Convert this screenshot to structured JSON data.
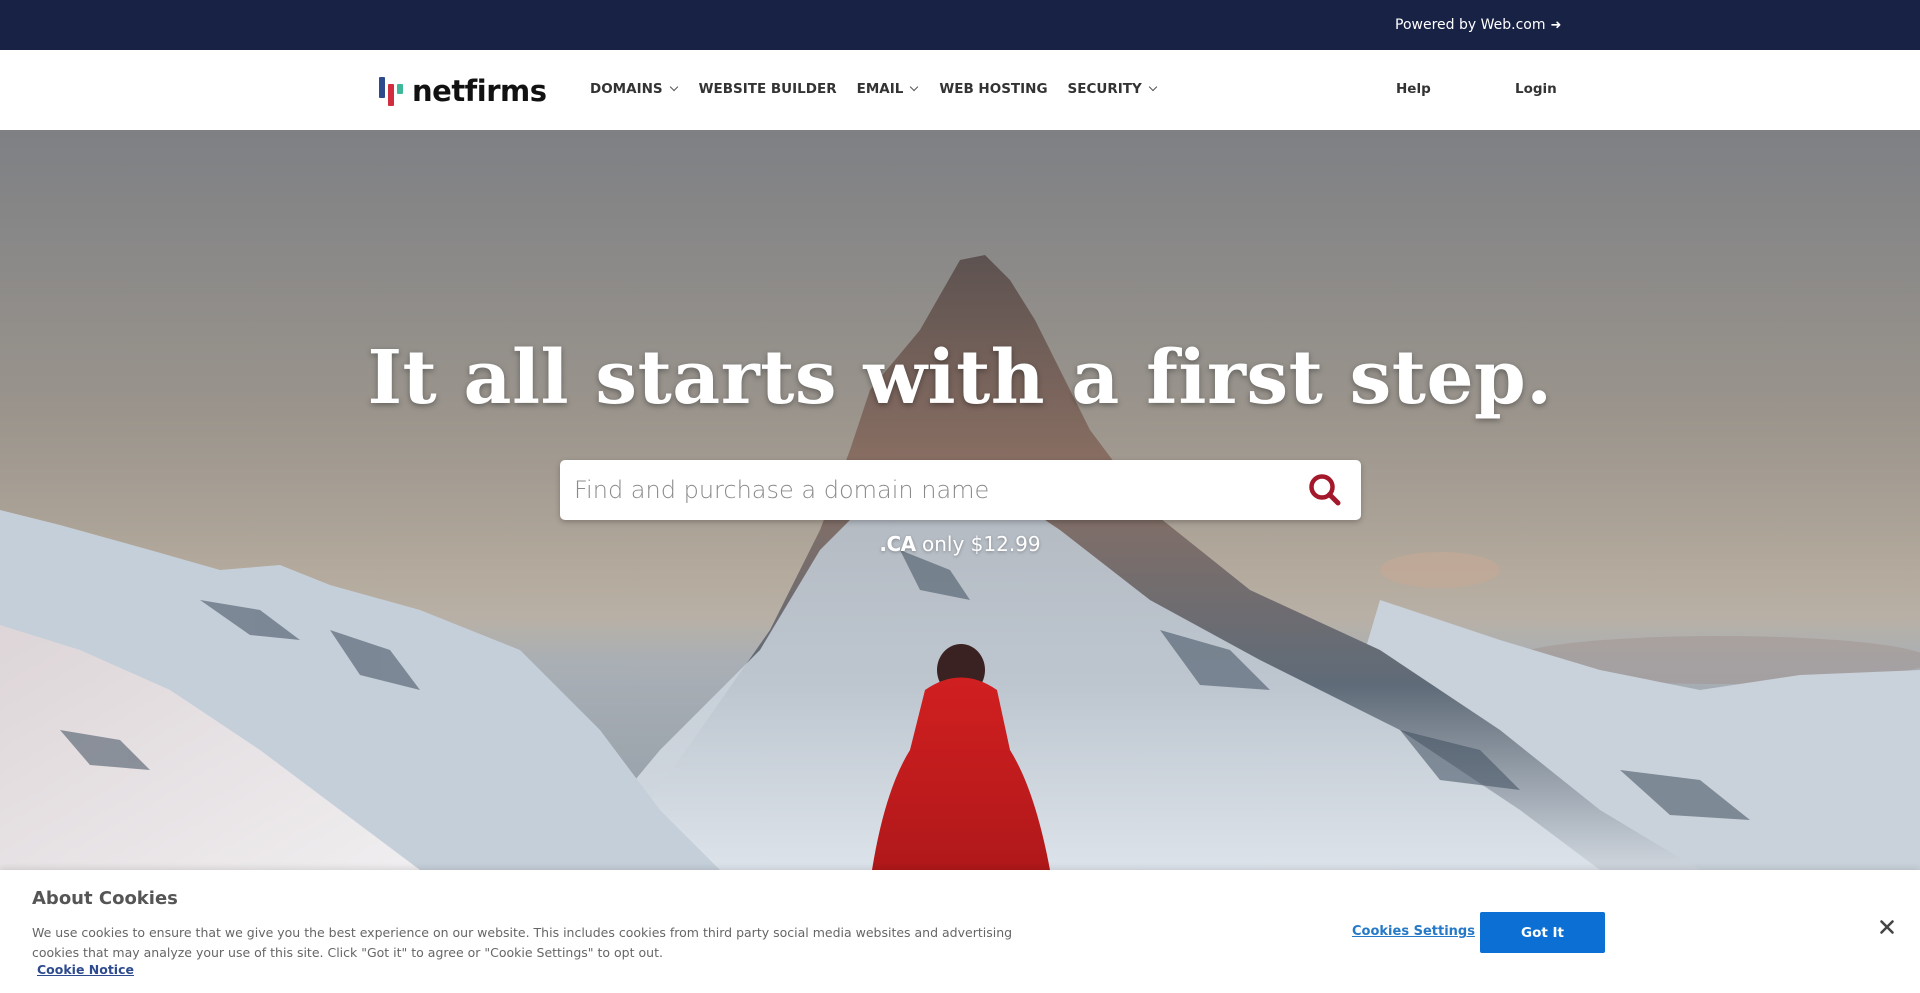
{
  "topbar": {
    "powered_by": "Powered by Web.com",
    "arrow_icon": "arrow-right-icon"
  },
  "nav": {
    "logo_text": "netfirms",
    "logo_colors": [
      "#2c4a8c",
      "#d12d3e",
      "#3fb89a"
    ],
    "items": [
      {
        "label": "DOMAINS",
        "dropdown": true
      },
      {
        "label": "WEBSITE BUILDER",
        "dropdown": false
      },
      {
        "label": "EMAIL",
        "dropdown": true
      },
      {
        "label": "WEB HOSTING",
        "dropdown": false
      },
      {
        "label": "SECURITY",
        "dropdown": true
      }
    ],
    "help": "Help",
    "login": "Login"
  },
  "hero": {
    "title": "It all starts with a first step.",
    "search": {
      "placeholder": "Find and purchase a domain name",
      "value": "",
      "icon": "search-icon",
      "icon_color": "#a3182a"
    },
    "promo": {
      "tld": ".CA",
      "text": " only $12.99"
    }
  },
  "cookie": {
    "title": "About Cookies",
    "text": "We use cookies to ensure that we give you the best experience on our website. This includes cookies from third party social media websites and advertising cookies that may analyze your use of this site. Click \"Got it\" to agree or \"Cookie Settings\" to opt out.",
    "notice_link": "Cookie Notice",
    "settings_label": "Cookies Settings",
    "accept_label": "Got It",
    "accept_color": "#0b6fd3",
    "close_icon": "close-icon"
  },
  "colors": {
    "topbar_bg": "#172245",
    "accent_red": "#a3182a",
    "link_blue": "#2579c7"
  }
}
